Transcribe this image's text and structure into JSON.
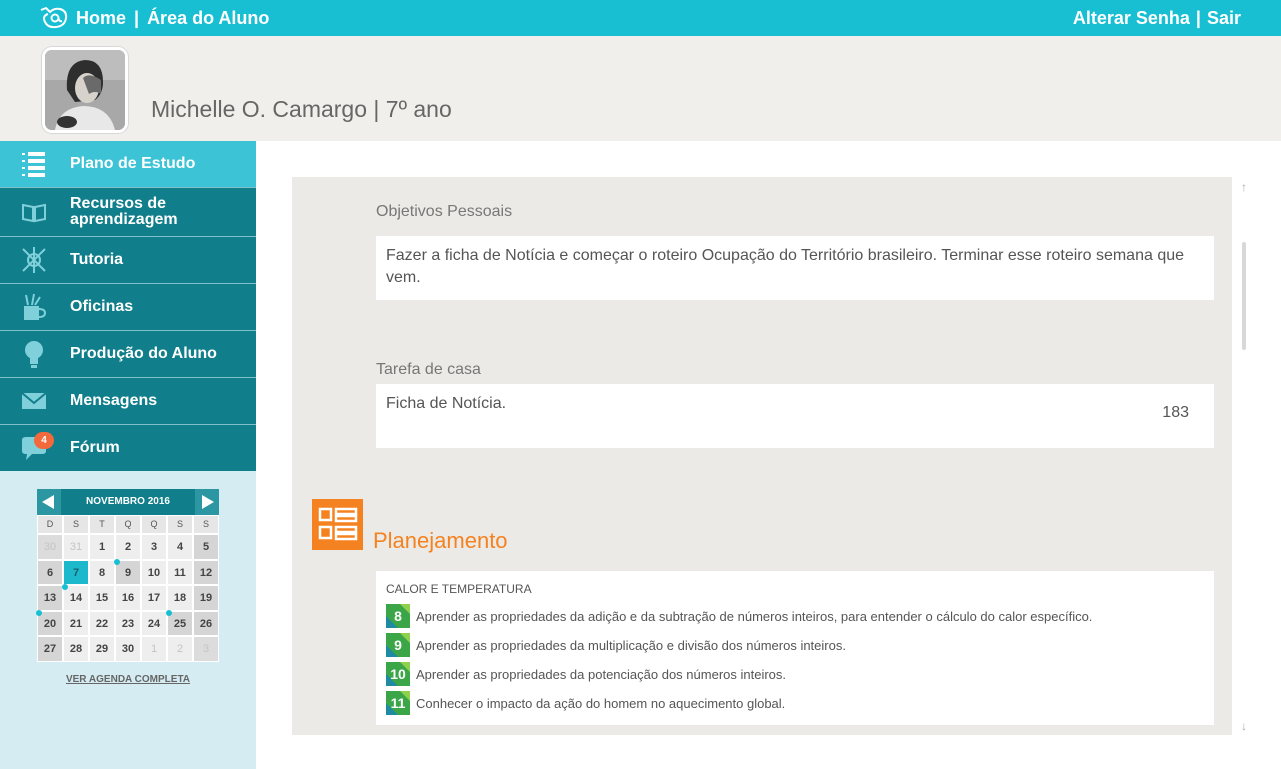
{
  "header": {
    "home_label": "Home",
    "separator": "|",
    "area_label": "Área do Aluno",
    "change_password_label": "Alterar Senha",
    "logout_label": "Sair"
  },
  "profile": {
    "name": "Michelle O. Camargo | 7º ano"
  },
  "sidebar": {
    "items": [
      {
        "label": "Plano de Estudo",
        "icon": "numbered-list-icon"
      },
      {
        "label": "Recursos de aprendizagem",
        "icon": "open-book-icon"
      },
      {
        "label": "Tutoria",
        "icon": "compass-icon"
      },
      {
        "label": "Oficinas",
        "icon": "pencil-cup-icon"
      },
      {
        "label": "Produção do Aluno",
        "icon": "lightbulb-icon"
      },
      {
        "label": "Mensagens",
        "icon": "envelope-icon"
      },
      {
        "label": "Fórum",
        "icon": "speech-bubble-icon",
        "badge": "4"
      }
    ]
  },
  "calendar": {
    "month_label": "NOVEMBRO 2016",
    "weekdays": [
      "D",
      "S",
      "T",
      "Q",
      "Q",
      "S",
      "S"
    ],
    "days": [
      "30",
      "31",
      "1",
      "2",
      "3",
      "4",
      "5",
      "6",
      "7",
      "8",
      "9",
      "10",
      "11",
      "12",
      "13",
      "14",
      "15",
      "16",
      "17",
      "18",
      "19",
      "20",
      "21",
      "22",
      "23",
      "24",
      "25",
      "26",
      "27",
      "28",
      "29",
      "30",
      "1",
      "2",
      "3"
    ],
    "link_label": "VER AGENDA COMPLETA"
  },
  "main": {
    "personal_goals_label": "Objetivos Pessoais",
    "personal_goals_text": "Fazer a ficha de Notícia e começar o roteiro Ocupação do Território brasileiro. Terminar esse roteiro semana que vem.",
    "homework_label": "Tarefa de casa",
    "homework_text": "Ficha de Notícia.",
    "homework_count": "183",
    "planning_title": "Planejamento",
    "planning_subject": "CALOR E TEMPERATURA",
    "objectives": [
      {
        "number": "8",
        "text": "Aprender as propriedades da adição e da subtração de números inteiros, para entender o cálculo do calor específico."
      },
      {
        "number": "9",
        "text": "Aprender as propriedades da multiplicação e divisão dos números inteiros."
      },
      {
        "number": "10",
        "text": "Aprender as propriedades da potenciação dos números inteiros."
      },
      {
        "number": "11",
        "text": "Conhecer o impacto da ação do homem no aquecimento global."
      }
    ]
  },
  "colors": {
    "header": "#18bfd3",
    "nav": "#107e8b",
    "nav_active": "#3cc3d5",
    "accent_orange": "#f58220",
    "badge": "#f26a3c"
  }
}
